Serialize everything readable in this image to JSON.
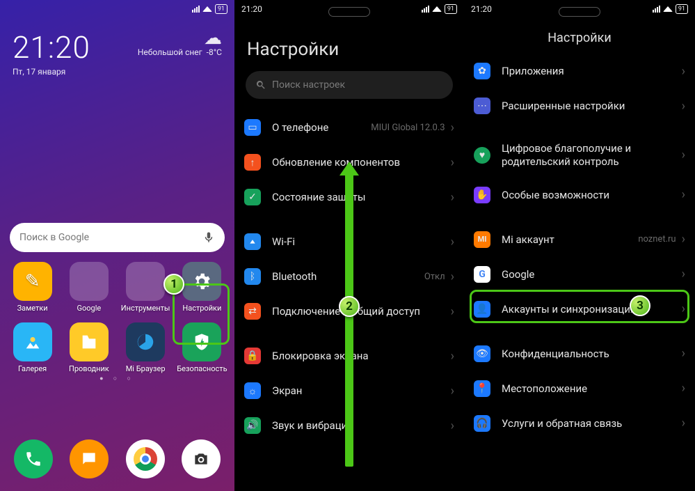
{
  "statusbar": {
    "time": "21:20",
    "battery": "91"
  },
  "home": {
    "clock": "21:20",
    "date": "Пт, 17 января",
    "weather_text": "Небольшой снег",
    "weather_temp": "-8°C",
    "search_placeholder": "Поиск в Google",
    "apps": {
      "notes": "Заметки",
      "google": "Google",
      "tools": "Инструменты",
      "settings": "Настройки",
      "gallery": "Галерея",
      "files": "Проводник",
      "browser": "Mi Браузер",
      "security": "Безопасность"
    }
  },
  "settings2": {
    "title": "Настройки",
    "search": "Поиск настроек",
    "rows": {
      "about": "О телефоне",
      "about_sub": "MIUI Global 12.0.3",
      "update": "Обновление компонентов",
      "protection": "Состояние защиты",
      "wifi": "Wi-Fi",
      "bt": "Bluetooth",
      "bt_sub": "Откл",
      "tether": "Подключение и общий доступ",
      "lock": "Блокировка экрана",
      "display": "Экран",
      "sound": "Звук и вибрация"
    }
  },
  "settings3": {
    "title": "Настройки",
    "rows": {
      "apps": "Приложения",
      "advanced": "Расширенные настройки",
      "wellbeing": "Цифровое благополучие и родительский контроль",
      "accessibility": "Особые возможности",
      "mi": "Mi аккаунт",
      "mi_sub": "noznet.ru",
      "google": "Google",
      "accounts": "Аккаунты и синхронизация",
      "privacy": "Конфиденциальность",
      "location": "Местоположение",
      "feedback": "Услуги и обратная связь"
    }
  },
  "steps": {
    "s1": "1",
    "s2": "2",
    "s3": "3"
  }
}
